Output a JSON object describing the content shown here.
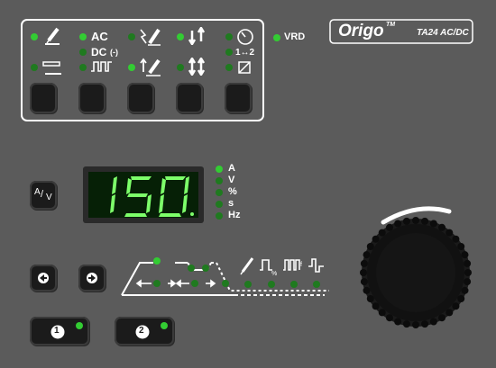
{
  "brand": {
    "name": "Origo",
    "tm": "TM",
    "model": "TA24 AC/DC"
  },
  "colors": {
    "panel": "#5b5b5b",
    "line": "#ffffff",
    "button": "#1b1b1b",
    "led_on": "#33cc33",
    "led_off": "#1f7a1f",
    "display_bg": "#062006",
    "display_digit": "#7dff6a"
  },
  "top_group": {
    "col1": {
      "icon_top": "tig-torch-icon",
      "icon_bottom": "stick-electrode-icon"
    },
    "col2": {
      "ac_label": "AC",
      "dc_label": "DC",
      "dc_suffix": "(-)",
      "pulse_icon": "pulse-icon"
    },
    "col3": {
      "icon_top": "hf-start-icon",
      "icon_bottom": "lift-arc-icon"
    },
    "col4": {
      "icon_top": "2-stroke-icon",
      "icon_bottom": "4-stroke-icon"
    },
    "col5": {
      "icon_top": "clock-icon",
      "mid_label": "1↔2",
      "icon_bottom": "square-icon"
    }
  },
  "vrd_label": "VRD",
  "display": {
    "value": "150"
  },
  "units": [
    "A",
    "V",
    "%",
    "s",
    "Hz"
  ],
  "av_button": {
    "a": "A",
    "sep": "/",
    "v": "V"
  },
  "memory_buttons": [
    "1",
    "2"
  ],
  "process_icons": [
    "stick-torch-icon",
    "pulse-percent-icon",
    "pulse-frequency-icon",
    "ac-balance-icon"
  ]
}
